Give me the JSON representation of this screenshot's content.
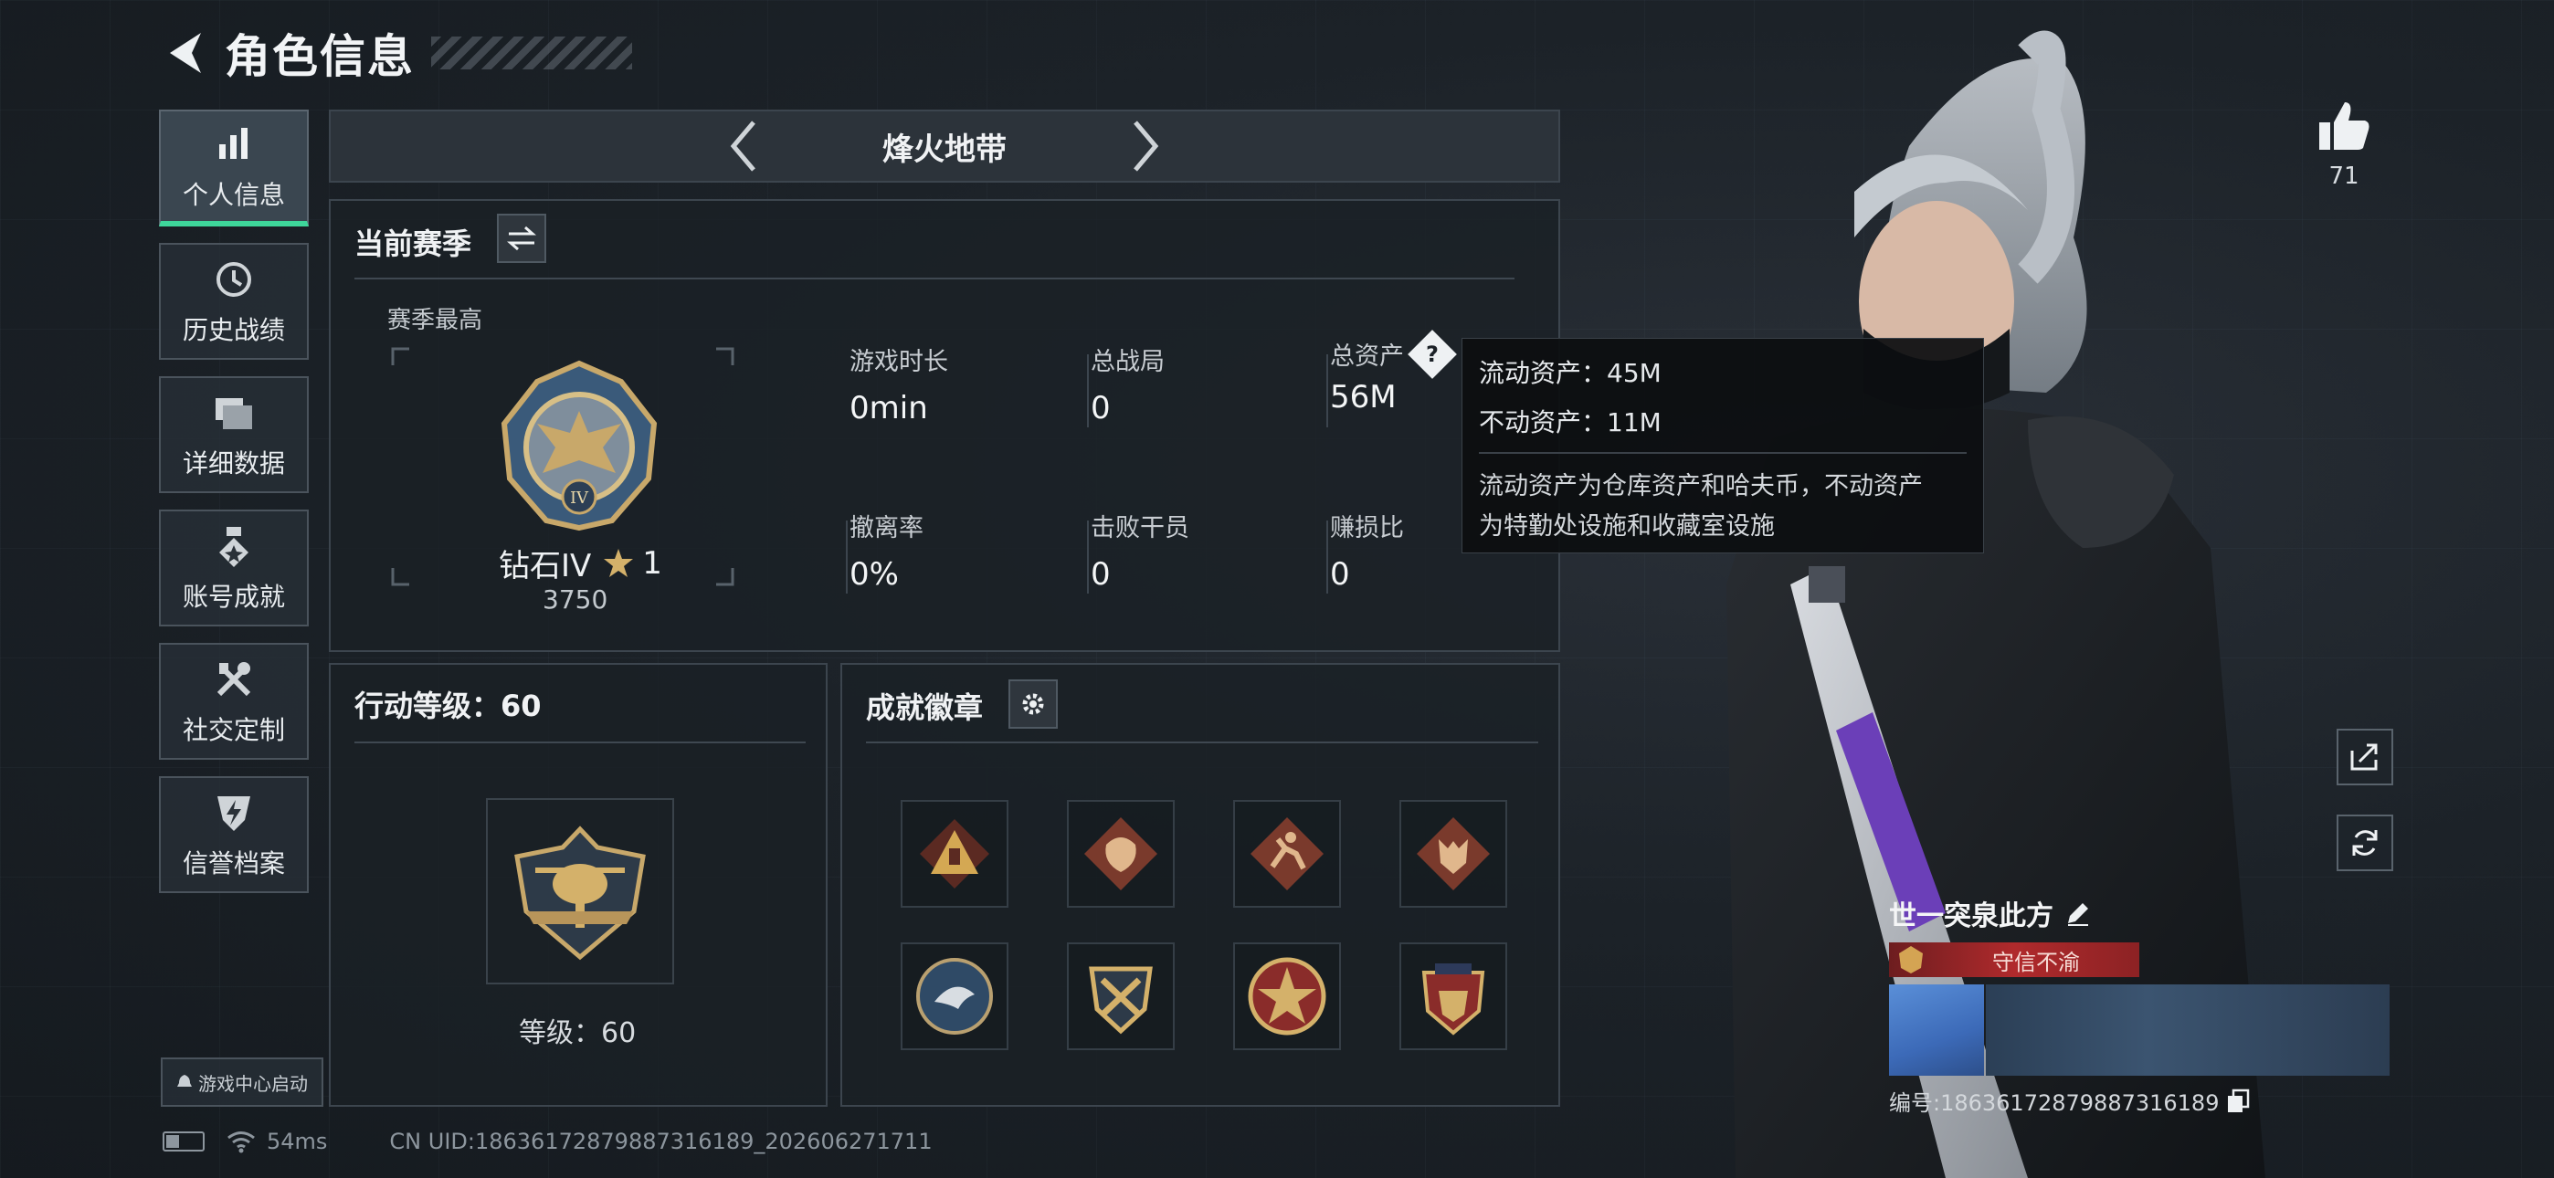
{
  "header": {
    "title": "角色信息"
  },
  "sidebar": {
    "items": [
      {
        "label": "个人信息",
        "icon": "bar-chart-icon",
        "active": true
      },
      {
        "label": "历史战绩",
        "icon": "history-icon"
      },
      {
        "label": "详细数据",
        "icon": "folder-icon"
      },
      {
        "label": "账号成就",
        "icon": "medal-icon"
      },
      {
        "label": "社交定制",
        "icon": "tools-icon"
      },
      {
        "label": "信誉档案",
        "icon": "shield-bolt-icon"
      }
    ],
    "launch_label": "游戏中心启动"
  },
  "mode": {
    "label": "烽火地带"
  },
  "season": {
    "title": "当前赛季",
    "best_label": "赛季最高",
    "rank_name": "钻石IV",
    "rank_stars": "1",
    "rank_points": "3750",
    "stats": [
      {
        "label": "游戏时长",
        "value": "0min"
      },
      {
        "label": "总战局",
        "value": "0"
      },
      {
        "label": "总资产",
        "value": "56M",
        "has_help": true
      },
      {
        "label": "撤离率",
        "value": "0%"
      },
      {
        "label": "击败干员",
        "value": "0"
      },
      {
        "label": "赚损比",
        "value": "0"
      }
    ]
  },
  "tooltip": {
    "liquid": "流动资产：45M",
    "fixed": "不动资产：11M",
    "desc_line1": "流动资产为仓库资产和哈夫币，不动资产",
    "desc_line2": "为特勤处设施和收藏室设施"
  },
  "action_level": {
    "title": "行动等级：60",
    "caption": "等级：60"
  },
  "badges": {
    "title": "成就徽章",
    "items": [
      "triangle-badge-icon",
      "dragon-badge-icon",
      "runner-badge-icon",
      "wolf-badge-icon",
      "eagle-badge-icon",
      "crossed-guns-badge-icon",
      "star-badge-icon",
      "heraldry-badge-icon"
    ]
  },
  "likes": {
    "count": "71"
  },
  "profile": {
    "name": "世一突泉此方",
    "honor": "守信不渝",
    "number_line": "编号:186361728798873161​89"
  },
  "status": {
    "ping": "54ms",
    "uid": "CN UID:186361728798873161​89_202606271711"
  },
  "colors": {
    "accent": "#3ed69a",
    "honor_red": "#b02a2c",
    "panel_border": "#3c454e"
  }
}
